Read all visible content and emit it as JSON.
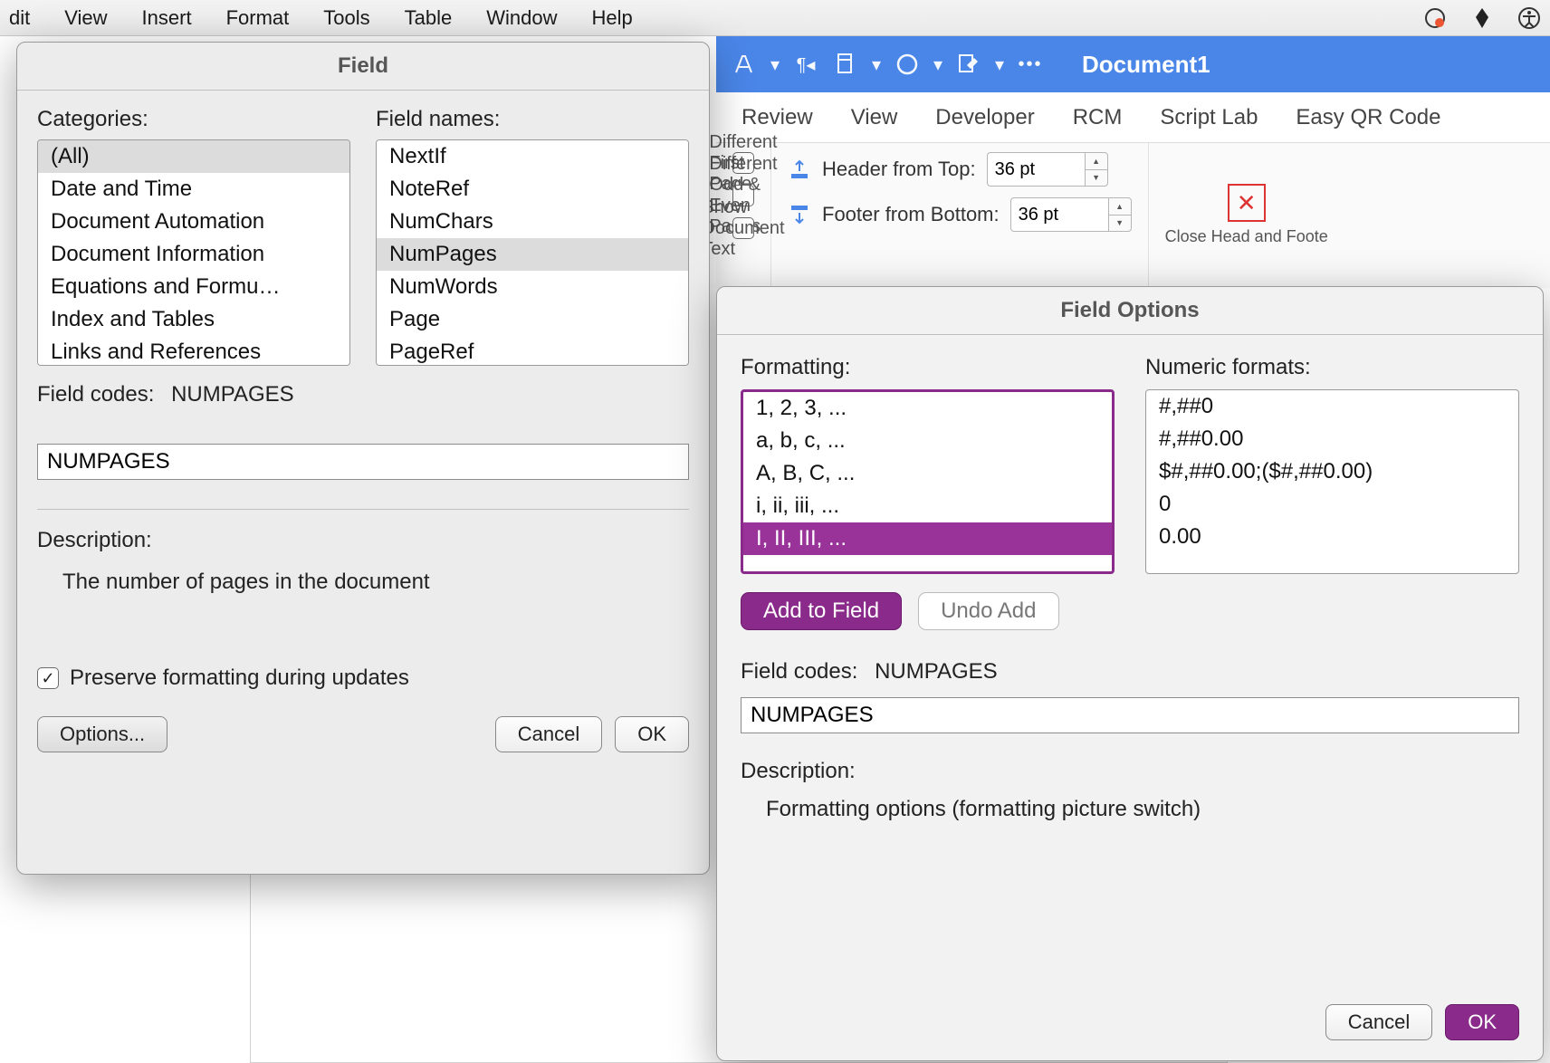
{
  "menubar": {
    "items": [
      "dit",
      "View",
      "Insert",
      "Format",
      "Tools",
      "Table",
      "Window",
      "Help"
    ]
  },
  "ribbon": {
    "document_name": "Document1"
  },
  "tabs": {
    "items": [
      "Review",
      "View",
      "Developer",
      "RCM",
      "Script Lab",
      "Easy QR Code"
    ]
  },
  "toolbar": {
    "different_first_page": "Different First Page",
    "different_odd_even": "Different Odd & Even Pages",
    "show_document_text": "Show Document Text",
    "header_from_top_label": "Header from Top:",
    "header_from_top_value": "36 pt",
    "footer_from_bottom_label": "Footer from Bottom:",
    "footer_from_bottom_value": "36 pt",
    "close_label": "Close Head\nand Foote"
  },
  "field_dialog": {
    "title": "Field",
    "categories_label": "Categories:",
    "field_names_label": "Field names:",
    "categories": [
      "(All)",
      "Date and Time",
      "Document Automation",
      "Document Information",
      "Equations and Formu…",
      "Index and Tables",
      "Links and References"
    ],
    "categories_selected": 0,
    "field_names": [
      "NextIf",
      "NoteRef",
      "NumChars",
      "NumPages",
      "NumWords",
      "Page",
      "PageRef"
    ],
    "field_names_selected": 3,
    "field_codes_label": "Field codes:",
    "field_codes_value": "NUMPAGES",
    "code_input_value": "NUMPAGES",
    "description_label": "Description:",
    "description_text": "The number of pages in the document",
    "preserve_checkbox_label": "Preserve formatting during updates",
    "preserve_checked": true,
    "options_button": "Options...",
    "cancel_button": "Cancel",
    "ok_button": "OK"
  },
  "field_options_dialog": {
    "title": "Field Options",
    "formatting_label": "Formatting:",
    "numeric_formats_label": "Numeric formats:",
    "formatting": [
      "1, 2, 3, ...",
      "a, b, c, ...",
      "A, B, C, ...",
      "i, ii, iii, ...",
      "I, II, III, ..."
    ],
    "formatting_selected": 4,
    "numeric_formats": [
      "#,##0",
      "#,##0.00",
      "$#,##0.00;($#,##0.00)",
      "0",
      "0.00"
    ],
    "add_to_field_button": "Add to Field",
    "undo_add_button": "Undo Add",
    "field_codes_label": "Field codes:",
    "field_codes_value": "NUMPAGES",
    "code_input_value": "NUMPAGES",
    "description_label": "Description:",
    "description_text": "Formatting options (formatting picture switch)",
    "cancel_button": "Cancel",
    "ok_button": "OK"
  }
}
